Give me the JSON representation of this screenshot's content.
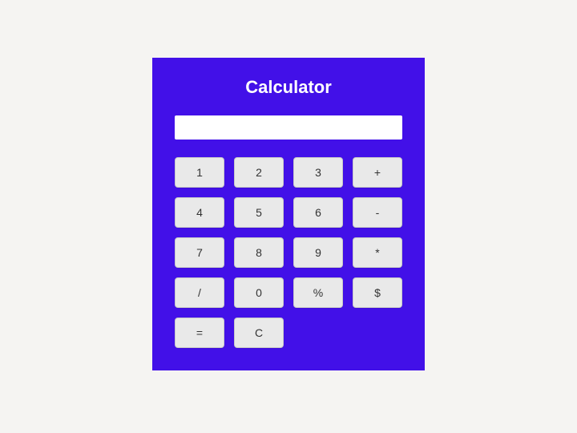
{
  "title": "Calculator",
  "display_value": "",
  "colors": {
    "panel": "#4210e8",
    "background": "#f5f4f2",
    "key": "#e9e9e9",
    "text_light": "#ffffff"
  },
  "keys": [
    {
      "name": "digit-1",
      "label": "1"
    },
    {
      "name": "digit-2",
      "label": "2"
    },
    {
      "name": "digit-3",
      "label": "3"
    },
    {
      "name": "op-plus",
      "label": "+"
    },
    {
      "name": "digit-4",
      "label": "4"
    },
    {
      "name": "digit-5",
      "label": "5"
    },
    {
      "name": "digit-6",
      "label": "6"
    },
    {
      "name": "op-minus",
      "label": "-"
    },
    {
      "name": "digit-7",
      "label": "7"
    },
    {
      "name": "digit-8",
      "label": "8"
    },
    {
      "name": "digit-9",
      "label": "9"
    },
    {
      "name": "op-multiply",
      "label": "*"
    },
    {
      "name": "op-divide",
      "label": "/"
    },
    {
      "name": "digit-0",
      "label": "0"
    },
    {
      "name": "op-percent",
      "label": "%"
    },
    {
      "name": "op-dollar",
      "label": "$"
    },
    {
      "name": "op-equals",
      "label": "="
    },
    {
      "name": "op-clear",
      "label": "C"
    }
  ]
}
